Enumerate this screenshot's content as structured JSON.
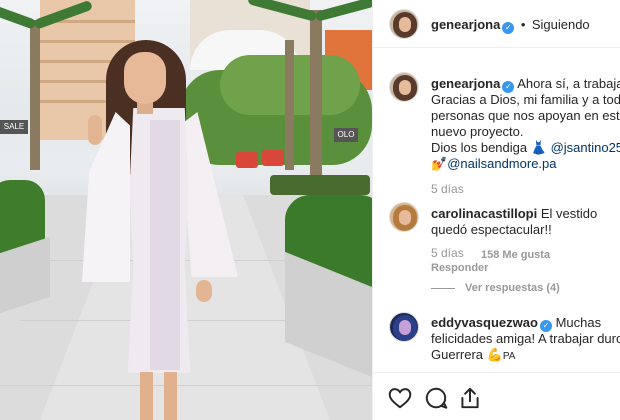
{
  "post": {
    "author": "genearjona",
    "following_label": "Siguiendo",
    "caption_lines": [
      "Ahora sí, a trabajar..",
      "Gracias a Dios, mi familia y a todas",
      "personas que nos apoyan en este",
      "nuevo proyecto.",
      "Dios los bendiga",
      "@nailsandmore.pa"
    ],
    "caption_emoji": "👗",
    "caption_mention_1": "@jsantino25",
    "caption_emoji_2": "💅",
    "caption_time": "5 días"
  },
  "comments": [
    {
      "user": "carolinacastillopi",
      "text_1": "El vestido",
      "text_2": "quedó espectacular!!",
      "time": "5 días",
      "likes": "158 Me gusta",
      "reply": "Responder",
      "view_replies": "Ver respuestas (4)"
    },
    {
      "user": "eddyvasquezwao",
      "text_1": "Muchas",
      "text_2": "felicidades amiga! A trabajar duro",
      "text_3": "Guerrera",
      "emoji": "💪",
      "suffix": "PA"
    }
  ],
  "photo": {
    "sign_text": "SALE",
    "sign_text_2": "OLO"
  },
  "icons": [
    "heart-icon",
    "comment-icon",
    "share-icon",
    "verified-badge-icon"
  ],
  "colors": {
    "verified_blue": "#3897f0",
    "mention": "#003569",
    "muted": "#999999"
  }
}
